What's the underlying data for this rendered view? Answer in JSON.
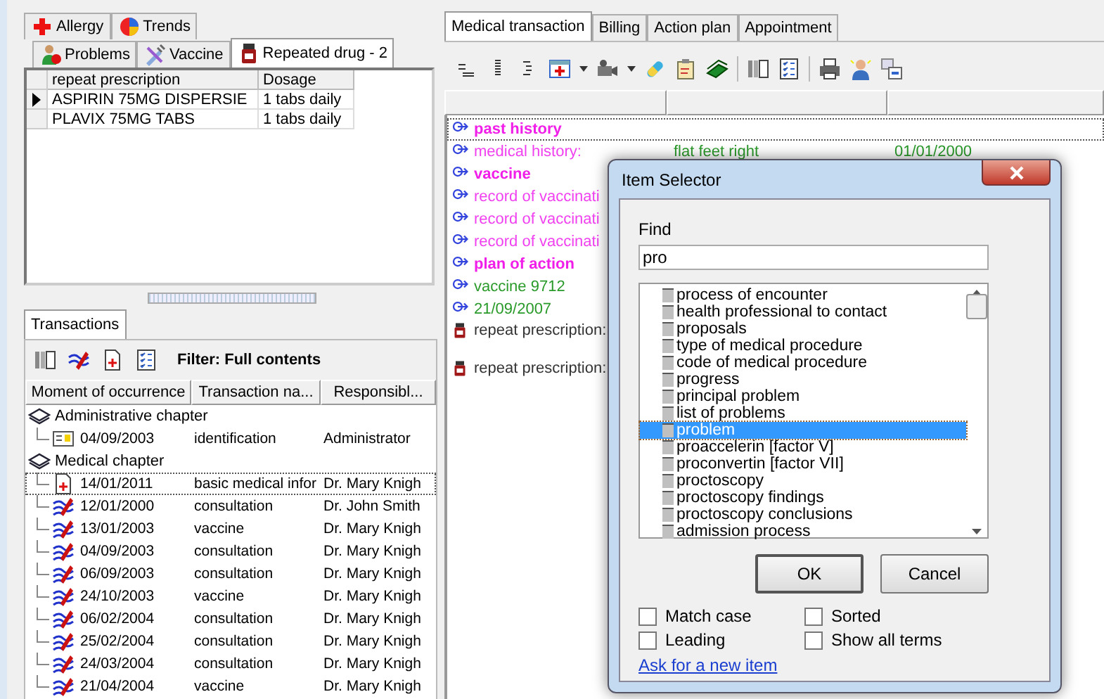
{
  "left_tabs": [
    [
      {
        "label": "Allergy",
        "selected": false
      },
      {
        "label": "Trends",
        "selected": false
      }
    ],
    [
      {
        "label": "Problems",
        "selected": false
      },
      {
        "label": "Vaccine",
        "selected": false
      },
      {
        "label": "Repeated drug - 2",
        "selected": true
      }
    ]
  ],
  "repeat_table": {
    "columns": [
      "repeat prescription",
      "Dosage"
    ],
    "rows": [
      {
        "cells": [
          "ASPIRIN 75MG DISPERSIE",
          "1 tabs daily"
        ],
        "selected": true
      },
      {
        "cells": [
          "PLAVIX 75MG TABS",
          "1 tabs daily"
        ],
        "selected": false
      }
    ]
  },
  "transactions_tab": {
    "label": "Transactions",
    "selected": true
  },
  "filter": "Filter: Full contents",
  "transactions": {
    "columns": [
      "Moment of occurrence",
      "Transaction na...",
      "Responsibl..."
    ],
    "chapters": [
      {
        "label": "Administrative chapter",
        "children": [
          {
            "kind": "identification",
            "date": "04/09/2003",
            "name": "identification",
            "responsible": "Administrator",
            "selected": false
          }
        ]
      },
      {
        "label": "Medical chapter",
        "children": [
          {
            "kind": "document",
            "date": "14/01/2011",
            "name": "basic medical infor",
            "responsible": "Dr. Mary Knigh",
            "selected": true
          },
          {
            "kind": "consultation",
            "date": "12/01/2000",
            "name": "consultation",
            "responsible": "Dr. John Smith",
            "selected": false
          },
          {
            "kind": "consultation",
            "date": "13/01/2003",
            "name": "vaccine",
            "responsible": "Dr. Mary Knigh",
            "selected": false
          },
          {
            "kind": "consultation",
            "date": "04/09/2003",
            "name": "consultation",
            "responsible": "Dr. Mary Knigh",
            "selected": false
          },
          {
            "kind": "consultation",
            "date": "06/09/2003",
            "name": "consultation",
            "responsible": "Dr. Mary Knigh",
            "selected": false
          },
          {
            "kind": "consultation",
            "date": "24/10/2003",
            "name": "vaccine",
            "responsible": "Dr. Mary Knigh",
            "selected": false
          },
          {
            "kind": "consultation",
            "date": "06/02/2004",
            "name": "consultation",
            "responsible": "Dr. Mary Knigh",
            "selected": false
          },
          {
            "kind": "consultation",
            "date": "25/02/2004",
            "name": "consultation",
            "responsible": "Dr. Mary Knigh",
            "selected": false
          },
          {
            "kind": "consultation",
            "date": "24/03/2004",
            "name": "consultation",
            "responsible": "Dr. Mary Knigh",
            "selected": false
          },
          {
            "kind": "consultation",
            "date": "21/04/2004",
            "name": "vaccine",
            "responsible": "Dr. Mary Knigh",
            "selected": false
          }
        ]
      }
    ]
  },
  "right_tabs": [
    {
      "label": "Medical transaction",
      "selected": true
    },
    {
      "label": "Billing",
      "selected": false
    },
    {
      "label": "Action plan",
      "selected": false
    },
    {
      "label": "Appointment",
      "selected": false
    }
  ],
  "entries": [
    {
      "kind": "heading",
      "cells": [
        "past history"
      ],
      "selected": true
    },
    {
      "kind": "entry",
      "cells": [
        "medical history:",
        "flat feet right",
        "01/01/2000"
      ],
      "selected": false
    },
    {
      "kind": "heading",
      "cells": [
        "vaccine"
      ],
      "selected": false
    },
    {
      "kind": "entry",
      "cells": [
        "record of vaccinati"
      ],
      "selected": false
    },
    {
      "kind": "entry",
      "cells": [
        "record of vaccinati"
      ],
      "selected": false
    },
    {
      "kind": "entry",
      "cells": [
        "record of vaccinati"
      ],
      "selected": false
    },
    {
      "kind": "heading",
      "cells": [
        "plan of action"
      ],
      "selected": false
    },
    {
      "kind": "value",
      "cells": [
        "vaccine 9712"
      ],
      "selected": false
    },
    {
      "kind": "value",
      "cells": [
        "21/09/2007"
      ],
      "selected": false
    },
    {
      "kind": "prescription",
      "cells": [
        "repeat prescription:"
      ],
      "selected": false
    },
    {
      "kind": "prescription",
      "cells": [
        "repeat prescription:"
      ],
      "selected": false
    }
  ],
  "dialog": {
    "title": "Item Selector",
    "find_label": "Find",
    "find_value": "pro",
    "items": [
      {
        "label": "process of encounter",
        "selected": false
      },
      {
        "label": "health professional to contact",
        "selected": false
      },
      {
        "label": "proposals",
        "selected": false
      },
      {
        "label": "type of medical procedure",
        "selected": false
      },
      {
        "label": "code of medical procedure",
        "selected": false
      },
      {
        "label": "progress",
        "selected": false
      },
      {
        "label": "principal problem",
        "selected": false
      },
      {
        "label": "list of problems",
        "selected": false
      },
      {
        "label": "problem",
        "selected": true
      },
      {
        "label": "proaccelerin [factor V]",
        "selected": false
      },
      {
        "label": "proconvertin [factor VII]",
        "selected": false
      },
      {
        "label": "proctoscopy",
        "selected": false
      },
      {
        "label": "proctoscopy findings",
        "selected": false
      },
      {
        "label": "proctoscopy conclusions",
        "selected": false
      },
      {
        "label": "admission process",
        "selected": false
      }
    ],
    "buttons": [
      "OK",
      "Cancel"
    ],
    "options": [
      {
        "label": "Match case",
        "checked": false
      },
      {
        "label": "Sorted",
        "checked": false
      },
      {
        "label": "Leading",
        "checked": false
      },
      {
        "label": "Show all terms",
        "checked": false
      }
    ],
    "link": "Ask for a new item"
  }
}
